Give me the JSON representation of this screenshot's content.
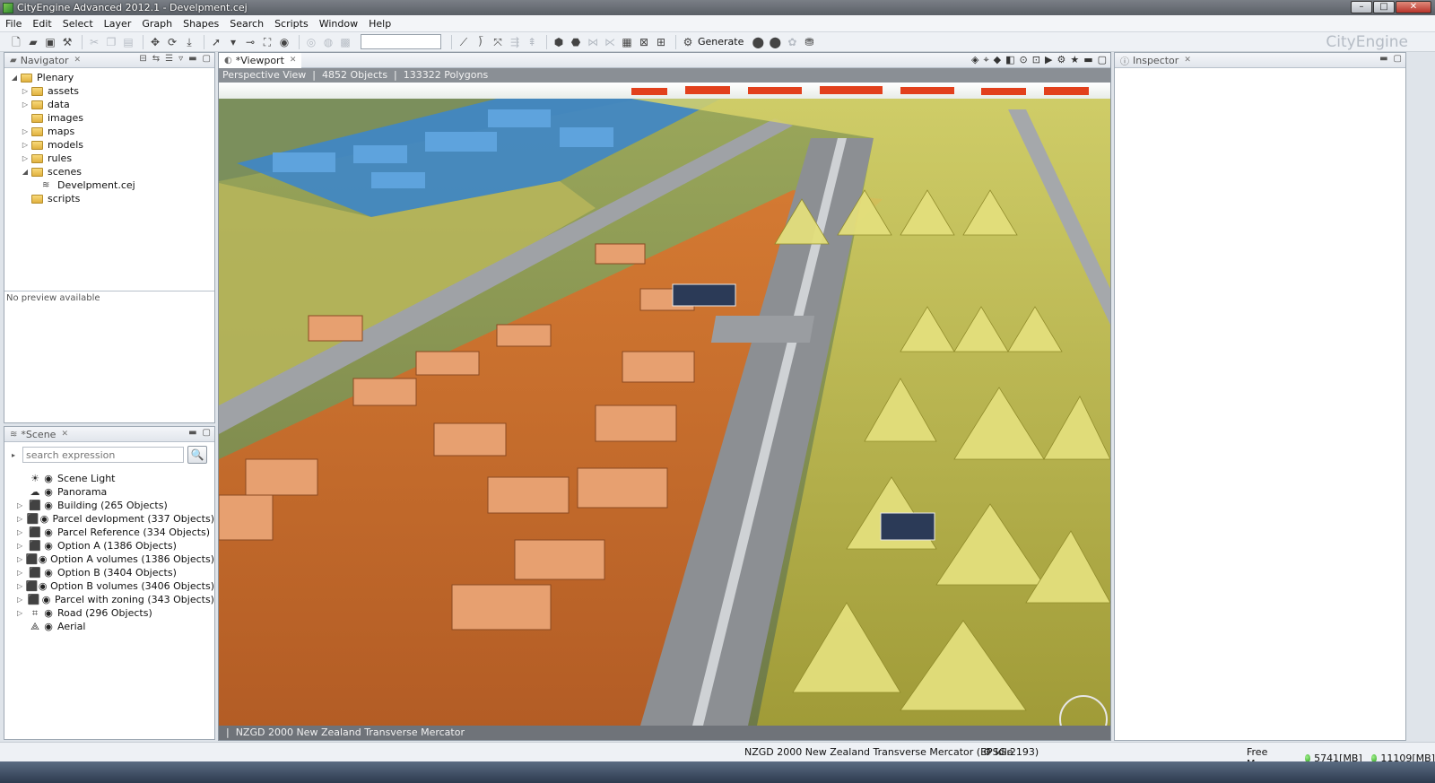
{
  "window": {
    "title": "CityEngine Advanced 2012.1 - Develpment.cej",
    "brand": "CityEngine"
  },
  "menu": [
    "File",
    "Edit",
    "Select",
    "Layer",
    "Graph",
    "Shapes",
    "Search",
    "Scripts",
    "Window",
    "Help"
  ],
  "toolbar": {
    "generate_label": "Generate"
  },
  "navigator": {
    "tab": "Navigator",
    "project": "Plenary",
    "folders": [
      {
        "name": "assets",
        "expandable": true
      },
      {
        "name": "data",
        "expandable": true
      },
      {
        "name": "images",
        "expandable": false
      },
      {
        "name": "maps",
        "expandable": true
      },
      {
        "name": "models",
        "expandable": true
      },
      {
        "name": "rules",
        "expandable": true
      },
      {
        "name": "scenes",
        "expandable": true,
        "expanded": true
      },
      {
        "name": "Develpment.cej",
        "file": true
      },
      {
        "name": "scripts",
        "expandable": false
      }
    ],
    "preview_text": "No preview available"
  },
  "scene": {
    "tab": "*Scene",
    "search_placeholder": "search expression",
    "layers": [
      {
        "label": "Scene Light",
        "icon": "sun-icon",
        "expandable": false
      },
      {
        "label": "Panorama",
        "icon": "cloud-icon",
        "expandable": false
      },
      {
        "label": "Building (265 Objects)",
        "icon": "cube-icon",
        "expandable": true
      },
      {
        "label": "Parcel devlopment (337 Objects)",
        "icon": "cube-icon",
        "expandable": true
      },
      {
        "label": "Parcel Reference (334 Objects)",
        "icon": "cube-icon",
        "expandable": true
      },
      {
        "label": "Option A (1386 Objects)",
        "icon": "cube-icon",
        "expandable": true
      },
      {
        "label": "Option A volumes (1386 Objects)",
        "icon": "cube-icon",
        "expandable": true
      },
      {
        "label": "Option B (3404 Objects)",
        "icon": "cube-icon",
        "expandable": true
      },
      {
        "label": "Option B volumes (3406 Objects)",
        "icon": "cube-icon",
        "expandable": true
      },
      {
        "label": "Parcel with zoning (343 Objects)",
        "icon": "cube-icon",
        "expandable": true
      },
      {
        "label": "Road (296 Objects)",
        "icon": "graph-icon",
        "expandable": true
      },
      {
        "label": "Aerial",
        "icon": "map-icon",
        "expandable": false
      }
    ]
  },
  "viewport": {
    "tab": "*Viewport",
    "view_name": "Perspective View",
    "objects": "4852 Objects",
    "polygons": "133322 Polygons",
    "crs_overlay": "NZGD 2000 New Zealand Transverse Mercator"
  },
  "inspector": {
    "tab": "Inspector"
  },
  "status": {
    "crs": "NZGD 2000 New Zealand Transverse Mercator (EPSG:2193)",
    "state": "Idle",
    "free_memory_label": "Free Memory:",
    "mem_used": "5741[MB]",
    "mem_total": "11109[MB]"
  },
  "colors": {
    "parcel_orange": "#d2692f",
    "zone_yellow": "#c8c23a",
    "zone_blue": "#3e86c8",
    "roof_red": "#e2401c",
    "road_gray": "#8c8f93"
  }
}
